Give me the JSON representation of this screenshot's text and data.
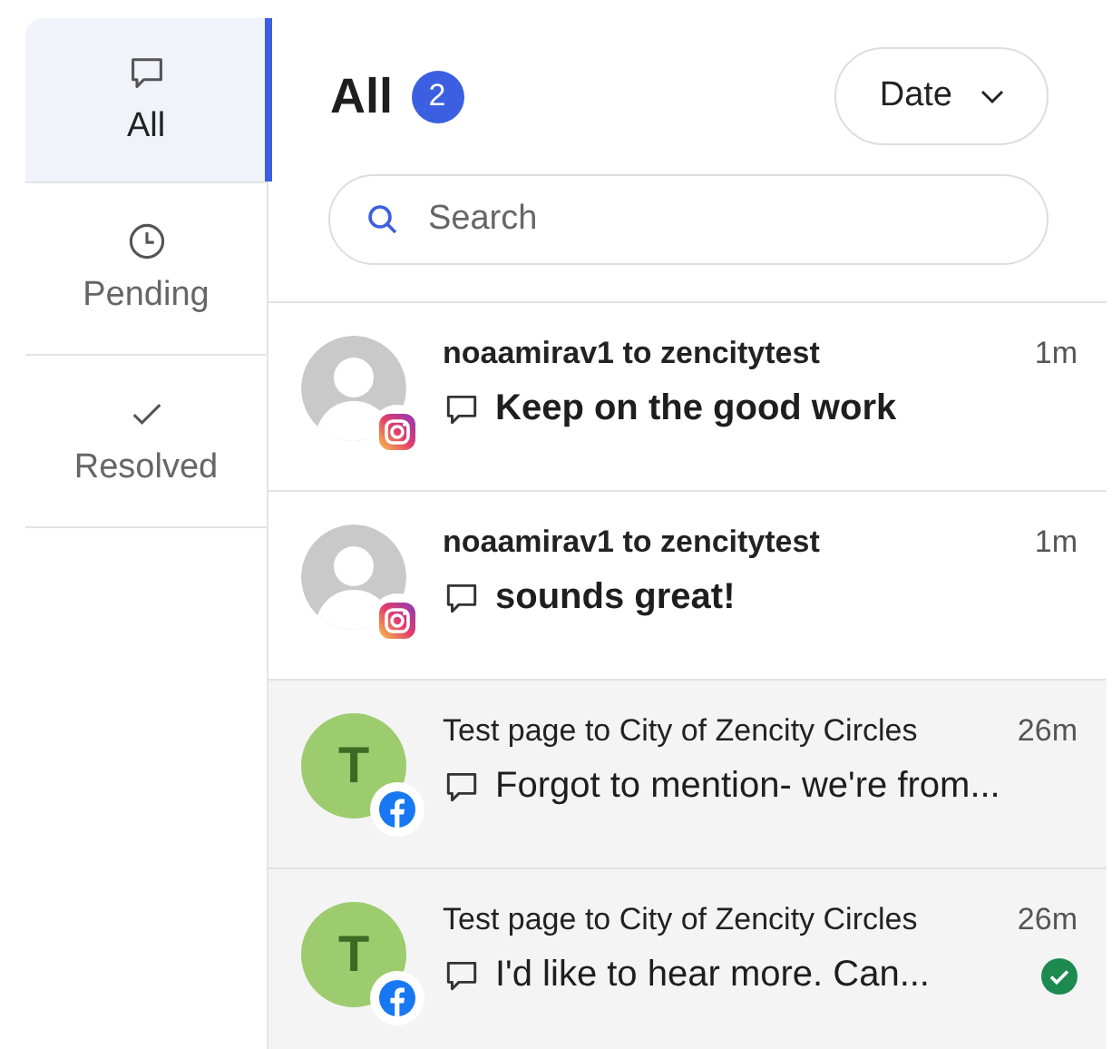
{
  "tabs": [
    {
      "label": "All",
      "selected": true
    },
    {
      "label": "Pending",
      "selected": false
    },
    {
      "label": "Resolved",
      "selected": false
    }
  ],
  "header": {
    "title": "All",
    "count": "2",
    "sort": "Date"
  },
  "search": {
    "placeholder": "Search"
  },
  "conversations": [
    {
      "from": "noaamirav1 to zencitytest",
      "message": "Keep on the good work",
      "time": "1m",
      "unread": true,
      "platform": {
        "kind": "instagram"
      },
      "avatar": {
        "kind": "silhouette"
      },
      "resolved": false
    },
    {
      "from": "noaamirav1 to zencitytest",
      "message": "sounds great!",
      "time": "1m",
      "unread": true,
      "platform": {
        "kind": "instagram"
      },
      "avatar": {
        "kind": "silhouette"
      },
      "resolved": false
    },
    {
      "from": "Test page to City of Zencity Circles",
      "message": "Forgot to mention- we're from...",
      "time": "26m",
      "unread": false,
      "platform": {
        "kind": "facebook"
      },
      "avatar": {
        "kind": "initial",
        "initial": "T"
      },
      "resolved": false
    },
    {
      "from": "Test page to City of Zencity Circles",
      "message": "I'd like to hear more. Can...",
      "time": "26m",
      "unread": false,
      "platform": {
        "kind": "facebook"
      },
      "avatar": {
        "kind": "initial",
        "initial": "T"
      },
      "resolved": true
    }
  ]
}
